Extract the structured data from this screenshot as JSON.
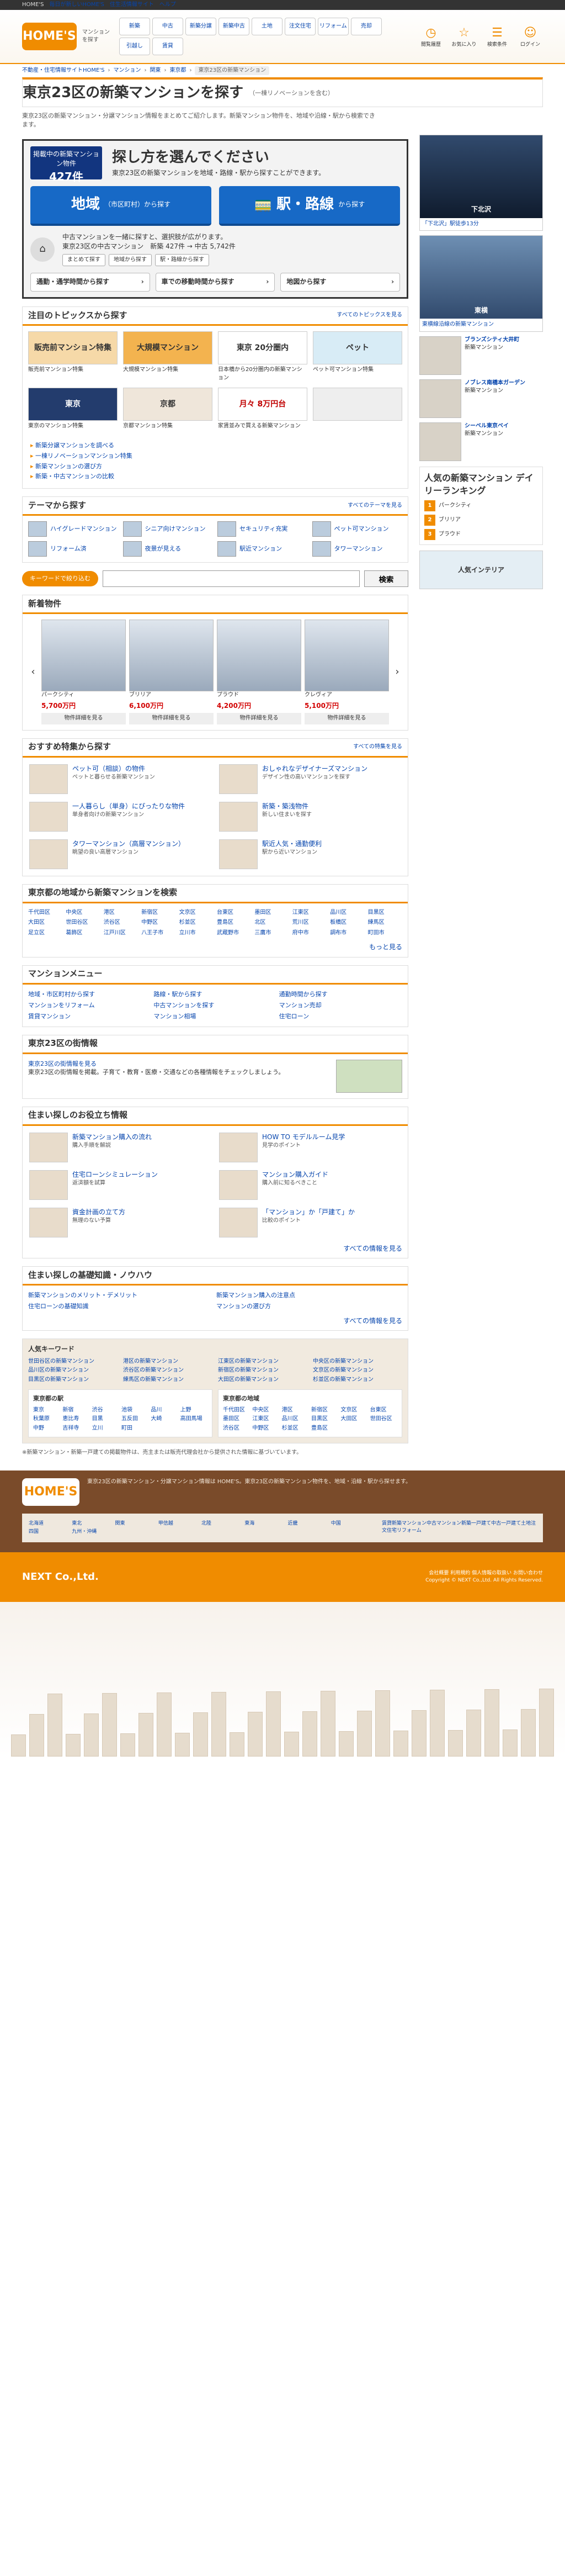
{
  "topbar": {
    "brand": "HOME'S",
    "links": [
      "毎日が新しいHOME'S",
      "住生活情報サイト",
      "ヘルプ"
    ]
  },
  "header": {
    "logo": "HOME'S",
    "category_label": "マンションを探す",
    "categories": [
      "新築",
      "中古",
      "新築分譲",
      "新築中古",
      "土地",
      "注文住宅",
      "リフォーム",
      "売却",
      "引越し",
      "賃貸"
    ],
    "icons": [
      {
        "label": "閲覧履歴",
        "icon": "clock-icon"
      },
      {
        "label": "お気に入り",
        "icon": "star-icon"
      },
      {
        "label": "検索条件",
        "icon": "list-icon"
      },
      {
        "label": "ログイン",
        "icon": "user-icon"
      }
    ]
  },
  "breadcrumb": [
    "不動産・住宅情報サイトHOME'S",
    "マンション",
    "関東",
    "東京都",
    "東京23区の新築マンション"
  ],
  "title": {
    "main": "東京23区の新築マンションを探す",
    "sub": "（一棟リノベーションを含む）"
  },
  "intro": "東京23区の新築マンション・分譲マンション情報をまとめてご紹介します。新築マンション物件を、地域や沿線・駅から検索できます。",
  "search": {
    "badge_label": "掲載中の新築マンション物件",
    "badge_count": "427件",
    "heading": "探し方を選んでください",
    "subheading": "東京23区の新築マンションを地域・路線・駅から探すことができます。",
    "area_button": "地域",
    "area_sub": "（市区町村）から探す",
    "station_button": "駅・路線",
    "station_sub": "から探す",
    "mid_note": "中古マンションを一緒に探すと、選択肢が広がります。",
    "mid_count": "東京23区の中古マンション　新築 427件 → 中古 5,742件",
    "mid_buttons": [
      "まとめて探す",
      "地域から探す",
      "駅・路線から探す"
    ],
    "bottom_buttons": [
      "通勤・通学時間から探す",
      "車での移動時間から探す",
      "地図から探す"
    ]
  },
  "topics": {
    "heading": "注目のトピックスから探す",
    "more": "すべてのトピックスを見る",
    "items": [
      {
        "image": "販売前マンション特集",
        "caption": "販売前マンション特集"
      },
      {
        "image": "大規模マンション",
        "caption": "大規模マンション特集"
      },
      {
        "image": "東京 20分圏内",
        "caption": "日本橋から20分圏内の新築マンション"
      },
      {
        "image": "ペット",
        "caption": "ペット可マンション特集"
      },
      {
        "image": "東京",
        "caption": "東京のマンション特集"
      },
      {
        "image": "京都",
        "caption": "京都マンション特集"
      },
      {
        "image": "月々 8万円台",
        "caption": "家賃並みで買える新築マンション"
      },
      {
        "image": "",
        "caption": ""
      }
    ],
    "links": [
      "新築分譲マンションを調べる",
      "一棟リノベーションマンション特集",
      "新築マンションの選び方",
      "新築・中古マンションの比較"
    ]
  },
  "themes": {
    "heading": "テーマから探す",
    "more": "すべてのテーマを見る",
    "items": [
      "ハイグレードマンション",
      "シニア向けマンション",
      "セキュリティ充実",
      "ペット可マンション",
      "リフォーム済",
      "夜景が見える",
      "駅近マンション",
      "タワーマンション"
    ]
  },
  "keyword": {
    "tag": "キーワードで絞り込む",
    "placeholder": "",
    "button": "検索"
  },
  "properties": {
    "heading": "新着物件",
    "items": [
      {
        "name": "パークシティ",
        "price": "5,700万円",
        "detail": "物件詳細を見る"
      },
      {
        "name": "ブリリア",
        "price": "6,100万円",
        "detail": "物件詳細を見る"
      },
      {
        "name": "プラウド",
        "price": "4,200万円",
        "detail": "物件詳細を見る"
      },
      {
        "name": "クレヴィア",
        "price": "5,100万円",
        "detail": "物件詳細を見る"
      }
    ]
  },
  "features": {
    "heading": "おすすめ特集から探す",
    "more": "すべての特集を見る",
    "items": [
      {
        "title": "ペット可（相談）の物件",
        "desc": "ペットと暮らせる新築マンション"
      },
      {
        "title": "おしゃれなデザイナーズマンション",
        "desc": "デザイン性の高いマンションを探す"
      },
      {
        "title": "一人暮らし（単身）にぴったりな物件",
        "desc": "単身者向けの新築マンション"
      },
      {
        "title": "新築・築浅物件",
        "desc": "新しい住まいを探す"
      },
      {
        "title": "タワーマンション（高層マンション）",
        "desc": "眺望の良い高層マンション"
      },
      {
        "title": "駅近人気・通勤便利",
        "desc": "駅から近いマンション"
      }
    ]
  },
  "areas": {
    "heading": "東京都の地域から新築マンションを検索",
    "items": [
      "千代田区",
      "中央区",
      "港区",
      "新宿区",
      "文京区",
      "台東区",
      "墨田区",
      "江東区",
      "品川区",
      "目黒区",
      "大田区",
      "世田谷区",
      "渋谷区",
      "中野区",
      "杉並区",
      "豊島区",
      "北区",
      "荒川区",
      "板橋区",
      "練馬区",
      "足立区",
      "葛飾区",
      "江戸川区",
      "八王子市",
      "立川市",
      "武蔵野市",
      "三鷹市",
      "府中市",
      "調布市",
      "町田市"
    ],
    "more": "もっと見る"
  },
  "menu": {
    "heading": "マンションメニュー",
    "items": [
      "地域・市区町村から探す",
      "路線・駅から探す",
      "通勤時間から探す",
      "マンションをリフォーム",
      "中古マンションを探す",
      "マンション売却",
      "賃貸マンション",
      "マンション相場",
      "住宅ローン"
    ]
  },
  "ward": {
    "heading": "東京23区の街情報",
    "link": "東京23区の街情報を見る",
    "desc": "東京23区の街情報を掲載。子育て・教育・医療・交通などの各種情報をチェックしましょう。"
  },
  "knowhow": {
    "heading": "住まい探しのお役立ち情報",
    "items": [
      {
        "title": "新築マンション購入の流れ",
        "desc": "購入手順を解説"
      },
      {
        "title": "HOW TO モデルルーム見学",
        "desc": "見学のポイント"
      },
      {
        "title": "住宅ローンシミュレーション",
        "desc": "返済額を試算"
      },
      {
        "title": "マンション購入ガイド",
        "desc": "購入前に知るべきこと"
      },
      {
        "title": "資金計画の立て方",
        "desc": "無理のない予算"
      },
      {
        "title": "「マンション」か「戸建て」か",
        "desc": "比較のポイント"
      }
    ],
    "more": "すべての情報を見る"
  },
  "qa": {
    "heading": "住まい探しの基礎知識・ノウハウ",
    "items": [
      "新築マンションのメリット・デメリット",
      "新築マンション購入の注意点",
      "住宅ローンの基礎知識",
      "マンションの選び方"
    ],
    "more": "すべての情報を見る"
  },
  "popular_keywords": {
    "heading": "人気キーワード",
    "items": [
      "世田谷区の新築マンション",
      "港区の新築マンション",
      "江東区の新築マンション",
      "中央区の新築マンション",
      "品川区の新築マンション",
      "渋谷区の新築マンション",
      "新宿区の新築マンション",
      "文京区の新築マンション",
      "目黒区の新築マンション",
      "練馬区の新築マンション",
      "大田区の新築マンション",
      "杉並区の新築マンション"
    ]
  },
  "regions": [
    {
      "heading": "東京都の駅",
      "items": [
        "東京",
        "新宿",
        "渋谷",
        "池袋",
        "品川",
        "上野",
        "秋葉原",
        "恵比寿",
        "目黒",
        "五反田",
        "大崎",
        "高田馬場",
        "中野",
        "吉祥寺",
        "立川",
        "町田"
      ]
    },
    {
      "heading": "東京都の地域",
      "items": [
        "千代田区",
        "中央区",
        "港区",
        "新宿区",
        "文京区",
        "台東区",
        "墨田区",
        "江東区",
        "品川区",
        "目黒区",
        "大田区",
        "世田谷区",
        "渋谷区",
        "中野区",
        "杉並区",
        "豊島区"
      ]
    }
  ],
  "note": "※新築マンション・新築一戸建ての掲載物件は、売主または販売代理会社から提供された情報に基づいています。",
  "sidebar": {
    "banners": [
      {
        "image": "下北沢",
        "caption": "「下北沢」駅徒歩13分"
      },
      {
        "image": "東横",
        "caption": "東横線沿線の新築マンション"
      }
    ],
    "ads": [
      {
        "title": "ブランズシティ大井町",
        "desc": "新築マンション"
      },
      {
        "title": "ノブレス南橋本ガーデン",
        "desc": "新築マンション"
      },
      {
        "title": "シーベル東京ベイ",
        "desc": "新築マンション"
      }
    ],
    "ranking": {
      "heading": "人気の新築マンション デイリーランキング",
      "items": [
        "パークシティ",
        "ブリリア",
        "プラウド"
      ]
    },
    "interior": "人気インテリア"
  },
  "footer": {
    "brand_text": "東京23区の新築マンション・分譲マンション情報は HOME'S。東京23区の新築マンション物件を、地域・沿線・駅から探せます。",
    "sitemap": [
      "北海道",
      "東北",
      "関東",
      "甲信越",
      "北陸",
      "東海",
      "近畿",
      "中国",
      "四国",
      "九州・沖縄"
    ],
    "services": [
      "賃貸",
      "新築マンション",
      "中古マンション",
      "新築一戸建て",
      "中古一戸建て",
      "土地",
      "注文住宅",
      "リフォーム"
    ],
    "company": "NEXT Co.,Ltd.",
    "links": [
      "会社概要",
      "利用規約",
      "個人情報の取扱い",
      "お問い合わせ"
    ],
    "copyright": "Copyright © NEXT Co.,Ltd. All Rights Reserved."
  }
}
